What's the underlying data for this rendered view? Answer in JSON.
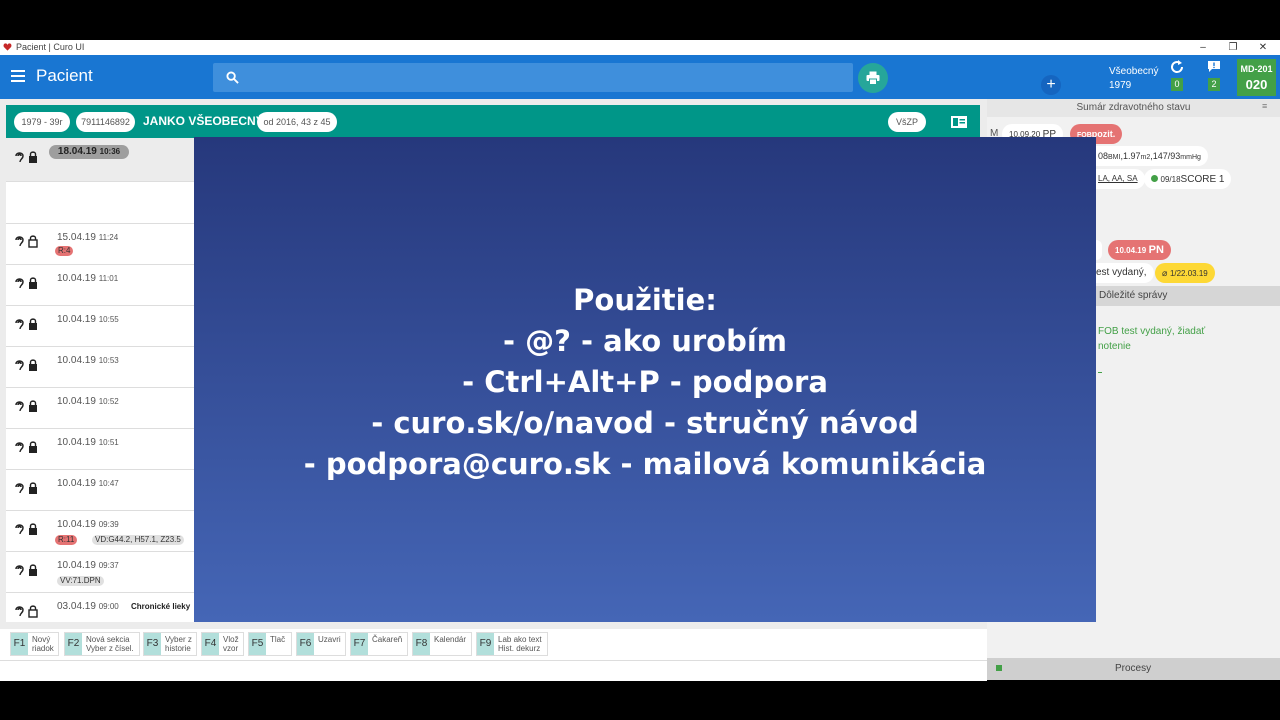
{
  "window": {
    "title": "Pacient | Curo UI",
    "min": "–",
    "max": "❐",
    "close": "✕"
  },
  "appbar": {
    "title": "Pacient",
    "search_placeholder": "",
    "user_name": "Všeobecný",
    "user_year": "1979",
    "sync_count": "0",
    "msg_count": "2",
    "md_code": "MD-201",
    "md_num": "020"
  },
  "patient": {
    "birth": "1979 - 39r",
    "id": "7911146892",
    "name": "JANKO VŠEOBECNÝ",
    "since": "od 2016, 43 z 45",
    "insurer": "VšZP"
  },
  "entries": [
    {
      "date": "18.04.19",
      "time": "10:36"
    },
    {
      "date": "15.04.19",
      "time": "11:24",
      "tag": "R:4"
    },
    {
      "date": "10.04.19",
      "time": "11:01"
    },
    {
      "date": "10.04.19",
      "time": "10:55"
    },
    {
      "date": "10.04.19",
      "time": "10:53"
    },
    {
      "date": "10.04.19",
      "time": "10:52"
    },
    {
      "date": "10.04.19",
      "time": "10:51"
    },
    {
      "date": "10.04.19",
      "time": "10:47"
    },
    {
      "date": "10.04.19",
      "time": "09:39",
      "tag": "R:11",
      "tag2": "VD:G44.2, H57.1, Z23.5"
    },
    {
      "date": "10.04.19",
      "time": "09:37",
      "tag2": "VV:71.DPN"
    },
    {
      "date": "03.04.19",
      "time": "09:00",
      "extra": "Chronické lieky"
    }
  ],
  "overlay": {
    "lines": [
      "Použitie:",
      "- @? - ako urobím",
      "- Ctrl+Alt+P - podpora",
      "- curo.sk/o/navod - stručný návod",
      "- podpora@curo.sk - mailová komunikácia"
    ]
  },
  "right": {
    "header": "Sumár zdravotného stavu",
    "m_label": "M",
    "pp_date": "10.09.20",
    "pp_label": "PP",
    "fob_prefix": "FOB",
    "fob_label": "pozit.",
    "bmi": "08",
    "bmi_unit": "BMI",
    "height": "1.97",
    "height_unit": "m2",
    "bp": "147/93",
    "bp_unit": "mmHg",
    "allergy": "LA, AA, SA",
    "score_date": "09/18",
    "score_label": "SCORE 1",
    "pn_date": "10.04.19",
    "pn_label": "PN",
    "test_text": "est vydaný,",
    "yellow_date": "1/22.03.19",
    "important_header": "Dôležité správy",
    "important_line1": "FOB test vydaný, žiadať",
    "important_line2": "notenie",
    "procesy": "Procesy"
  },
  "fkeys": [
    {
      "key": "F1",
      "l1": "Nový",
      "l2": "riadok"
    },
    {
      "key": "F2",
      "l1": "Nová sekcia",
      "l2": "Vyber z čísel."
    },
    {
      "key": "F3",
      "l1": "Vyber z",
      "l2": "historie"
    },
    {
      "key": "F4",
      "l1": "Vlož",
      "l2": "vzor"
    },
    {
      "key": "F5",
      "l1": "Tlač",
      "l2": ""
    },
    {
      "key": "F6",
      "l1": "Uzavri",
      "l2": ""
    },
    {
      "key": "F7",
      "l1": "Čakareň",
      "l2": ""
    },
    {
      "key": "F8",
      "l1": "Kalendár",
      "l2": ""
    },
    {
      "key": "F9",
      "l1": "Lab ako text",
      "l2": "Hist. dekurz"
    }
  ],
  "colors": {
    "appbar": "#1976d2",
    "patient_header": "#009688",
    "overlay_top": "#26387c",
    "overlay_bottom": "#4566b6",
    "accent_green": "#43a047"
  }
}
